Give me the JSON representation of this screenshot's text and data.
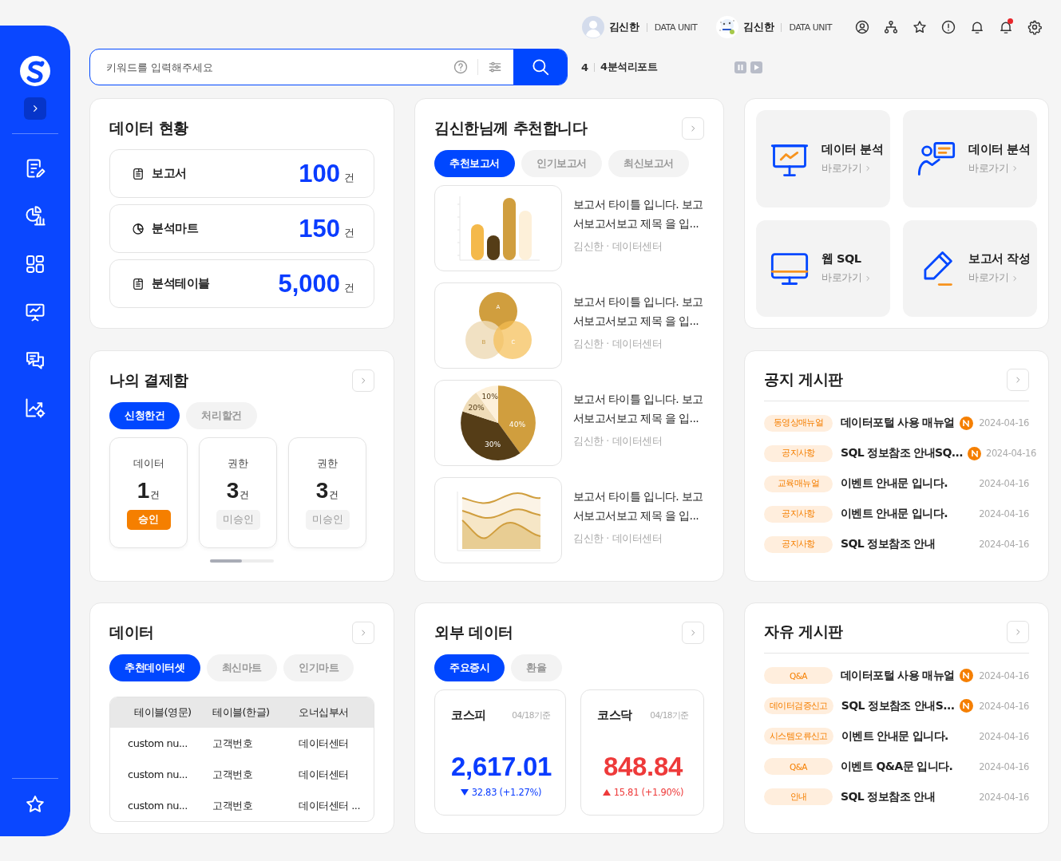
{
  "header": {
    "users": [
      {
        "name": "김신한",
        "unit": "DATA UNIT",
        "avatar": {
          "kind": "silhouette"
        }
      },
      {
        "name": "김신한",
        "unit": "DATA UNIT"
      }
    ],
    "actions": [
      {
        "kind": "user",
        "badge": false
      },
      {
        "kind": "org",
        "badge": false
      },
      {
        "kind": "star",
        "badge": false
      },
      {
        "kind": "alert",
        "badge": false
      },
      {
        "kind": "bell",
        "badge": false
      },
      {
        "kind": "bell",
        "badge": true
      },
      {
        "kind": "settings",
        "badge": false
      }
    ]
  },
  "search": {
    "placeholder": "키워드를 입력해주세요"
  },
  "ticker": {
    "count": "4",
    "label": "4분석리포트"
  },
  "data_status": {
    "title": "데이터 현황",
    "items": [
      {
        "kind": "document",
        "label": "보고서",
        "value": "100",
        "unit": "건"
      },
      {
        "kind": "pie",
        "label": "분석마트",
        "value": "150",
        "unit": "건"
      },
      {
        "kind": "document",
        "label": "분석테이블",
        "value": "5,000",
        "unit": "건"
      }
    ]
  },
  "approvals": {
    "title": "나의 결제함",
    "tabs": [
      {
        "label": "신청한건",
        "selected": true
      },
      {
        "label": "처리할건",
        "selected": false
      }
    ],
    "cards": [
      {
        "type": "데이터",
        "count": "1",
        "unit": "건",
        "status": "승인",
        "approved": true
      },
      {
        "type": "권한",
        "count": "3",
        "unit": "건",
        "status": "미승인",
        "approved": false
      },
      {
        "type": "권한",
        "count": "3",
        "unit": "건",
        "status": "미승인",
        "approved": false
      }
    ]
  },
  "recommend": {
    "title": "김신한님께 추천합니다",
    "tabs": [
      {
        "label": "추천보고서",
        "selected": true
      },
      {
        "label": "인기보고서",
        "selected": false
      },
      {
        "label": "최신보고서",
        "selected": false
      }
    ],
    "items": [
      {
        "thumbnail": {
          "kind": "bar"
        },
        "title": "보고서 타이틀 입니다. 보고서보고서보고 제목 을 입...",
        "meta": "김신한 · 데이터센터"
      },
      {
        "thumbnail": {
          "kind": "venn",
          "labels": [
            "A",
            "B",
            "C"
          ]
        },
        "title": "보고서 타이틀 입니다. 보고서보고서보고 제목 을 입...",
        "meta": "김신한 · 데이터센터"
      },
      {
        "thumbnail": {
          "kind": "pie",
          "labels": [
            "40%",
            "30%",
            "20%",
            "10%"
          ]
        },
        "title": "보고서 타이틀 입니다. 보고서보고서보고 제목 을 입...",
        "meta": "김신한 · 데이터센터"
      },
      {
        "thumbnail": {
          "kind": "area"
        },
        "title": "보고서 타이틀 입니다. 보고서보고서보고 제목 을 입...",
        "meta": "김신한 · 데이터센터"
      }
    ]
  },
  "quick_links": [
    {
      "kind": "presentation",
      "title": "데이터 분석",
      "link": "바로가기"
    },
    {
      "kind": "analyst",
      "title": "데이터 분석",
      "link": "바로가기"
    },
    {
      "kind": "monitor",
      "title": "웹 SQL",
      "link": "바로가기"
    },
    {
      "kind": "pen",
      "title": "보고서 작성",
      "link": "바로가기"
    }
  ],
  "notice": {
    "title": "공지 게시판",
    "posts": [
      {
        "tag": "동영상매뉴얼",
        "title": "데이터포털 사용 매뉴얼",
        "new": true,
        "date": "2024-04-16"
      },
      {
        "tag": "공지사항",
        "title": "SQL 정보참조 안내SQ...",
        "new": true,
        "date": "2024-04-16"
      },
      {
        "tag": "교육매뉴얼",
        "title": "이벤트 안내문 입니다.",
        "new": false,
        "date": "2024-04-16"
      },
      {
        "tag": "공지사항",
        "title": "이벤트 안내문 입니다.",
        "new": false,
        "date": "2024-04-16"
      },
      {
        "tag": "공지사항",
        "title": "SQL 정보참조 안내",
        "new": false,
        "date": "2024-04-16"
      }
    ]
  },
  "data": {
    "title": "데이터",
    "tabs": [
      {
        "label": "추천데이터셋",
        "selected": true
      },
      {
        "label": "최신마트",
        "selected": false
      },
      {
        "label": "인기마트",
        "selected": false
      }
    ],
    "table": {
      "columns": [
        "테이블(영문)",
        "테이블(한글)",
        "오너십부서"
      ],
      "rows": [
        [
          "custom nu...",
          "고객번호",
          "데이터센터"
        ],
        [
          "custom nu...",
          "고객번호",
          "데이터센터"
        ],
        [
          "custom nu...",
          "고객번호",
          "데이터센터 ..."
        ]
      ]
    }
  },
  "external": {
    "title": "외부 데이터",
    "tabs": [
      {
        "label": "주요증시",
        "selected": true
      },
      {
        "label": "환율",
        "selected": false
      }
    ],
    "indices": [
      {
        "name": "코스피",
        "date": "04/18기준",
        "value": "2,617.01",
        "kind": "down",
        "change": "32.83 (+1.27%)"
      },
      {
        "name": "코스닥",
        "date": "04/18기준",
        "value": "848.84",
        "kind": "up",
        "change": "15.81 (+1.90%)"
      }
    ]
  },
  "free": {
    "title": "자유 게시판",
    "posts": [
      {
        "tag": "Q&A",
        "title": "데이터포털 사용 매뉴얼",
        "new": true,
        "date": "2024-04-16"
      },
      {
        "tag": "데이터검증신고",
        "title": "SQL 정보참조 안내S...",
        "new": true,
        "date": "2024-04-16"
      },
      {
        "tag": "시스템오류신고",
        "title": "이벤트 안내문 입니다.",
        "new": false,
        "date": "2024-04-16"
      },
      {
        "tag": "Q&A",
        "title": "이벤트 Q&A문 입니다.",
        "new": false,
        "date": "2024-04-16"
      },
      {
        "tag": "안내",
        "title": "SQL 정보참조 안내",
        "new": false,
        "date": "2024-04-16"
      }
    ]
  }
}
